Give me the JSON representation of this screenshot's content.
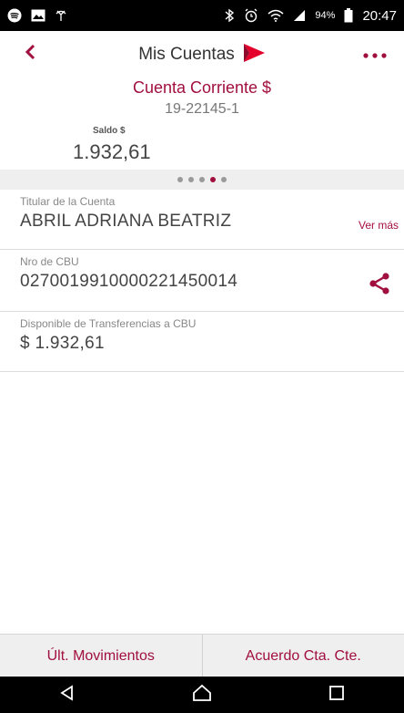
{
  "status_bar": {
    "battery": "94%",
    "time": "20:47",
    "icons": [
      "spotify-icon",
      "gallery-icon",
      "signal-icon",
      "bluetooth-icon",
      "alarm-icon",
      "wifi-icon",
      "cell-signal-icon",
      "battery-icon"
    ]
  },
  "header": {
    "title": "Mis Cuentas",
    "back_icon": "chevron-left-icon",
    "more_icon": "more-dots-icon",
    "brand_icon": "flag-arrow-icon"
  },
  "account": {
    "type": "Cuenta Corriente $",
    "number": "19-22145-1",
    "balance_label": "Saldo $",
    "balance_value": "1.932,61"
  },
  "pager": {
    "pages": 5,
    "active_index": 3
  },
  "details": {
    "holder_label": "Titular de la Cuenta",
    "holder_value": "ABRIL ADRIANA BEATRIZ",
    "ver_mas": "Ver más",
    "cbu_label": "Nro de CBU",
    "cbu_value": "0270019910000221450014",
    "available_label": "Disponible de Transferencias a CBU",
    "available_value": "$ 1.932,61"
  },
  "bottom_buttons": {
    "movements": "Últ. Movimientos",
    "agreement": "Acuerdo Cta. Cte."
  },
  "colors": {
    "accent": "#a10f3e",
    "brand_red": "#e4002b"
  }
}
